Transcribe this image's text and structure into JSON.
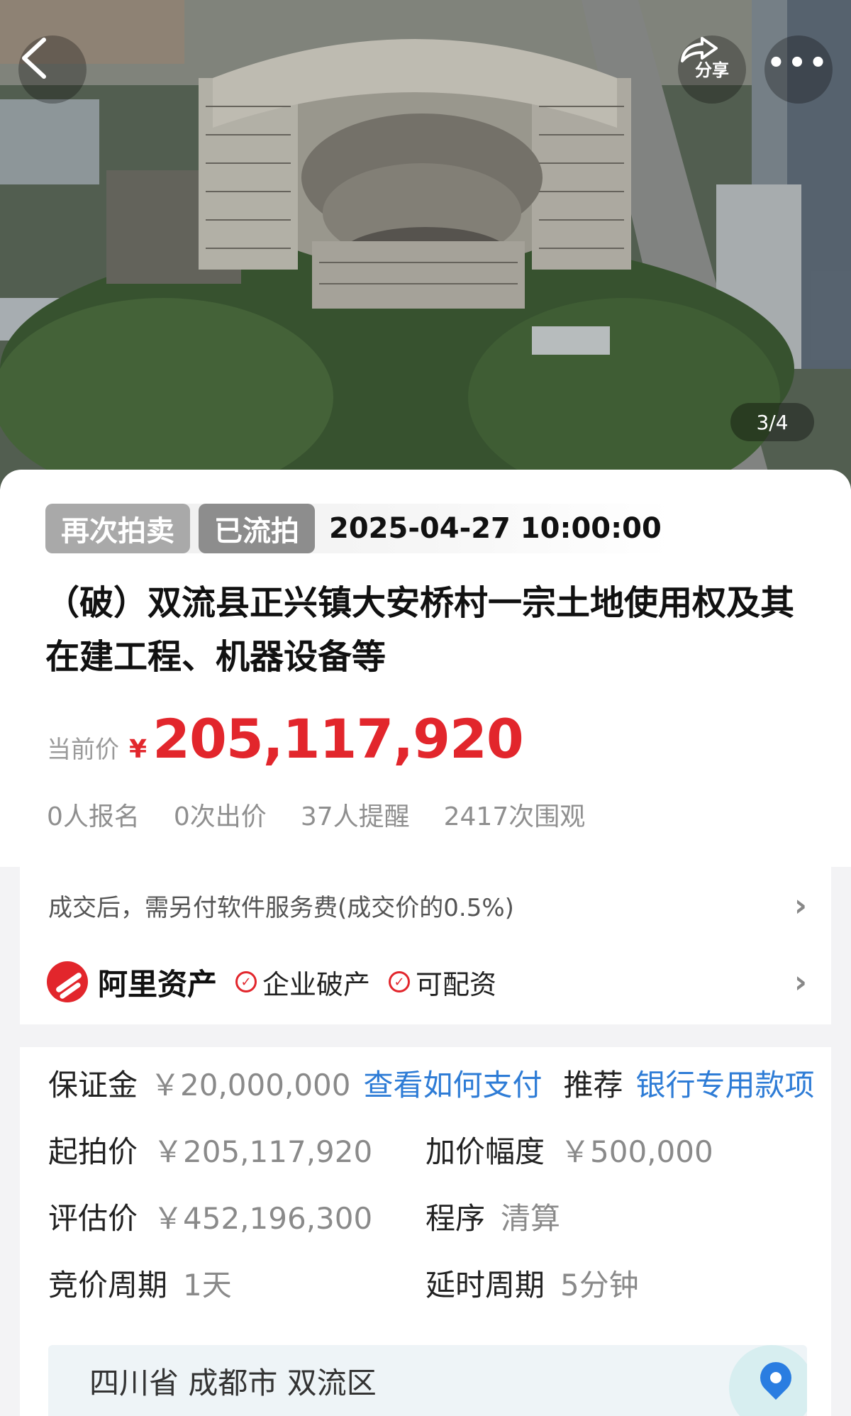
{
  "hero": {
    "share_label": "分享",
    "more_label": "•••",
    "counter": "3/4"
  },
  "listing": {
    "tag_reauction": "再次拍卖",
    "tag_status": "已流拍",
    "datetime": "2025-04-27 10:00:00",
    "title": "（破）双流县正兴镇大安桥村一宗土地使用权及其在建工程、机器设备等",
    "price_label": "当前价",
    "price_currency": "¥",
    "price_value": "205,117,920",
    "stats": [
      "0人报名",
      "0次出价",
      "37人提醒",
      "2417次围观"
    ]
  },
  "fee": {
    "text": "成交后，需另付软件服务费(成交价的0.5%)"
  },
  "brand": {
    "name": "阿里资产",
    "badges": [
      "企业破产",
      "可配资"
    ]
  },
  "details": {
    "deposit_label": "保证金",
    "deposit_value": "￥20,000,000",
    "pay_link": "查看如何支付",
    "recommend_label": "推荐",
    "recommend_link": "银行专用款项",
    "start_price_label": "起拍价",
    "start_price_value": "￥205,117,920",
    "increment_label": "加价幅度",
    "increment_value": "￥500,000",
    "appraisal_label": "评估价",
    "appraisal_value": "￥452,196,300",
    "procedure_label": "程序",
    "procedure_value": "清算",
    "bid_cycle_label": "竞价周期",
    "bid_cycle_value": "1天",
    "delay_label": "延时周期",
    "delay_value": "5分钟"
  },
  "location": {
    "address": "四川省  成都市  双流区"
  },
  "colors": {
    "price_red": "#e2262c",
    "link_blue": "#2e7cd6",
    "tag_gray": "#a9a9a9"
  }
}
